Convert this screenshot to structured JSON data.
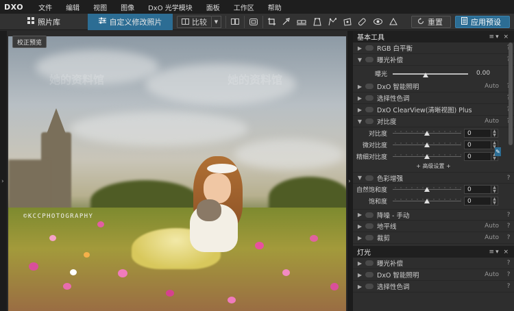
{
  "menubar": {
    "logo": "DXO",
    "items": [
      "文件",
      "编辑",
      "视图",
      "图像",
      "DxO 光学模块",
      "面板",
      "工作区",
      "帮助"
    ]
  },
  "toolbar": {
    "library_tab": "照片库",
    "customize_tab": "自定义修改照片",
    "compare_label": "比较",
    "reset_label": "重置",
    "apply_preset_label": "应用预设"
  },
  "viewer": {
    "preview_button": "校正预览",
    "photo_credit": "©KCCPHOTOGRAPHY",
    "watermark": "她的资料馆"
  },
  "panel_basic": {
    "title": "基本工具",
    "rows": [
      {
        "label": "RGB 白平衡",
        "aux": "",
        "expanded": false
      },
      {
        "label": "曝光补偿",
        "aux": "",
        "expanded": true
      }
    ],
    "exposure": {
      "label": "曝光",
      "value": "0.00"
    },
    "rows2": [
      {
        "label": "DxO 智能照明",
        "aux": "Auto",
        "expanded": false
      },
      {
        "label": "选择性色调",
        "aux": "",
        "expanded": false
      },
      {
        "label": "DxO ClearView(清晰视图) Plus",
        "aux": "",
        "expanded": false
      },
      {
        "label": "对比度",
        "aux": "Auto",
        "expanded": true
      }
    ],
    "contrast_sliders": [
      {
        "label": "对比度",
        "value": "0"
      },
      {
        "label": "微对比度",
        "value": "0"
      },
      {
        "label": "精细对比度",
        "value": "0"
      }
    ],
    "advanced_label": "+ 高级设置 +",
    "color_row": {
      "label": "色彩增强",
      "aux": ""
    },
    "color_sliders": [
      {
        "label": "自然饱和度",
        "value": "0"
      },
      {
        "label": "饱和度",
        "value": "0"
      }
    ],
    "rows3": [
      {
        "label": "降噪 - 手动",
        "aux": ""
      },
      {
        "label": "地平线",
        "aux": "Auto"
      },
      {
        "label": "裁剪",
        "aux": "Auto"
      }
    ]
  },
  "panel_light": {
    "title": "灯光",
    "rows": [
      {
        "label": "曝光补偿",
        "aux": ""
      },
      {
        "label": "DxO 智能照明",
        "aux": "Auto"
      },
      {
        "label": "选择性色调",
        "aux": ""
      }
    ]
  },
  "colors": {
    "accent": "#2c6d94",
    "panel_bg": "#2e2e2e",
    "header_bg": "#1f1f1f"
  }
}
